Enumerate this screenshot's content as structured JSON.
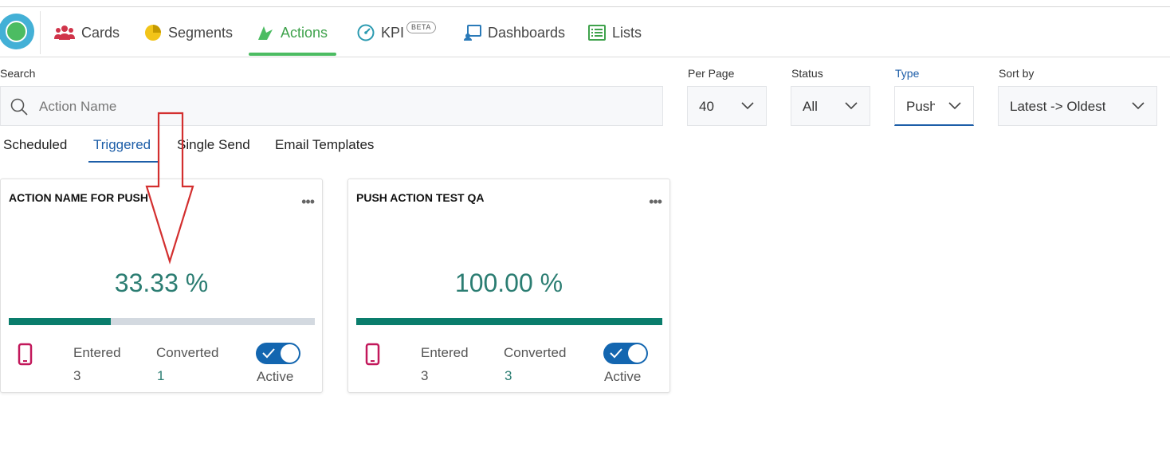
{
  "nav": {
    "items": [
      {
        "label": "Cards",
        "icon": "users-icon",
        "color": "#d0344a"
      },
      {
        "label": "Segments",
        "icon": "pie-chart-icon",
        "color": "#f2c418"
      },
      {
        "label": "Actions",
        "icon": "actions-icon",
        "color": "#4cbc62"
      },
      {
        "label": "KPI",
        "icon": "gauge-icon",
        "color": "#2a9ab0"
      },
      {
        "label": "Dashboards",
        "icon": "dashboard-icon",
        "color": "#2a7ab8"
      },
      {
        "label": "Lists",
        "icon": "list-icon",
        "color": "#3fa24c"
      }
    ],
    "active": "Actions",
    "kpi_badge": "BETA"
  },
  "filters": {
    "search_label": "Search",
    "search_placeholder": "Action Name",
    "per_page_label": "Per Page",
    "per_page_value": "40",
    "status_label": "Status",
    "status_value": "All",
    "type_label": "Type",
    "type_value": "Push",
    "sort_label": "Sort by",
    "sort_value": "Latest -> Oldest"
  },
  "subtabs": [
    "Scheduled",
    "Triggered",
    "Single Send",
    "Email Templates"
  ],
  "active_subtab": "Triggered",
  "cards": [
    {
      "title": "ACTION NAME FOR PUSH",
      "percent": "33.33 %",
      "progress": 0.3333,
      "entered_label": "Entered",
      "entered": "3",
      "converted_label": "Converted",
      "converted": "1",
      "status_label": "Active",
      "menu": "•••"
    },
    {
      "title": "PUSH ACTION TEST QA",
      "percent": "100.00 %",
      "progress": 1.0,
      "entered_label": "Entered",
      "entered": "3",
      "converted_label": "Converted",
      "converted": "3",
      "status_label": "Active",
      "menu": "•••"
    }
  ],
  "colors": {
    "accent_green": "#4cbc62",
    "accent_blue": "#1d5ea8",
    "teal": "#2b7d72",
    "progress_fill": "#0a7d6c",
    "toggle": "#1366b0",
    "annotation_arrow": "#d32f2f",
    "phone_icon": "#c2185b"
  }
}
